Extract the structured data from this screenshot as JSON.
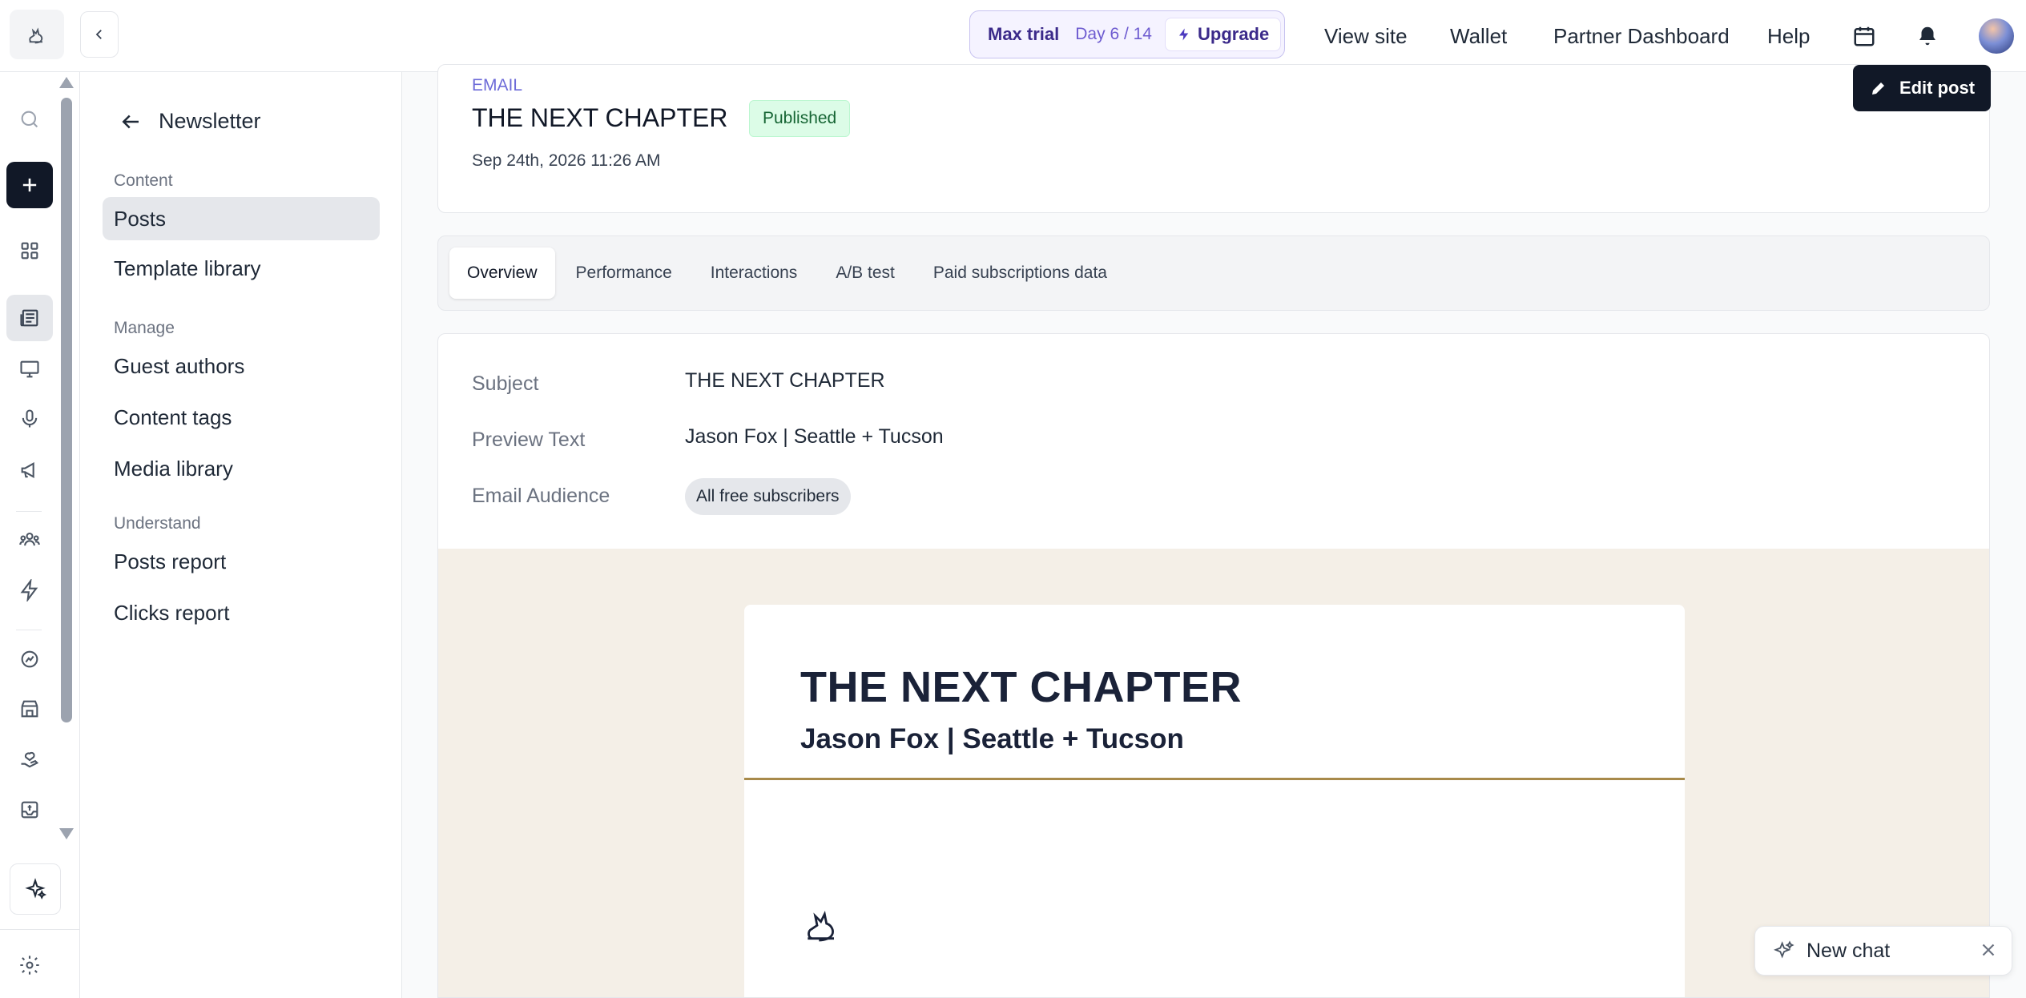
{
  "topbar": {
    "trial_label": "Max trial",
    "trial_day": "Day 6 / 14",
    "upgrade_label": "Upgrade",
    "nav": [
      "View site",
      "Wallet",
      "Partner Dashboard",
      "Help"
    ]
  },
  "subnav": {
    "back_title": "Newsletter",
    "sections": {
      "content": "Content",
      "manage": "Manage",
      "understand": "Understand"
    },
    "items": {
      "posts": "Posts",
      "template_library": "Template library",
      "guest_authors": "Guest authors",
      "content_tags": "Content tags",
      "media_library": "Media library",
      "posts_report": "Posts report",
      "clicks_report": "Clicks report"
    }
  },
  "post": {
    "type": "EMAIL",
    "title": "THE NEXT CHAPTER",
    "status": "Published",
    "date": "Sep 24th, 2026 11:26 AM",
    "edit_label": "Edit post"
  },
  "tabs": [
    "Overview",
    "Performance",
    "Interactions",
    "A/B test",
    "Paid subscriptions data"
  ],
  "details": {
    "subject_label": "Subject",
    "subject_value": "THE NEXT CHAPTER",
    "preview_label": "Preview Text",
    "preview_value": "Jason Fox | Seattle + Tucson",
    "audience_label": "Email Audience",
    "audience_value": "All free subscribers"
  },
  "email_preview": {
    "heading": "THE NEXT CHAPTER",
    "subheading": "Jason Fox | Seattle + Tucson",
    "accent_color": "#a88a4a",
    "background_color": "#f4efe7"
  },
  "chat": {
    "label": "New chat"
  },
  "colors": {
    "primary_dark": "#111827",
    "published_bg": "#dcfce7",
    "trial_accent": "#6d5bd0"
  }
}
